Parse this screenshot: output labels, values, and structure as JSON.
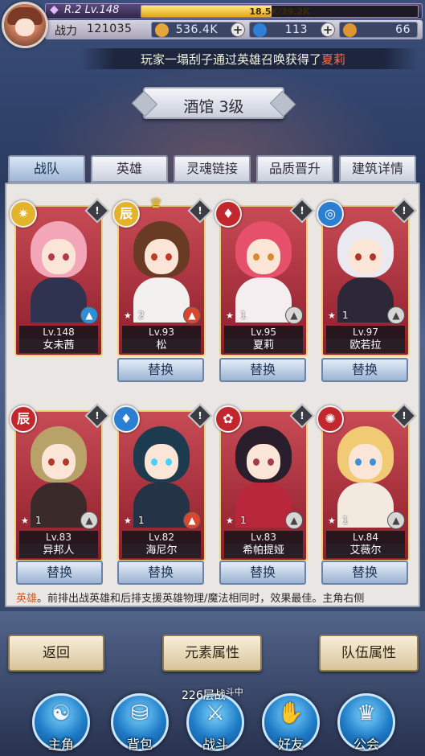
{
  "player": {
    "rank_icon": "rank-gem-icon",
    "rank_text": "R.2 Lv.148",
    "exp_text": "18.5K/39.2K",
    "exp_fraction": 0.47,
    "power_label": "战力",
    "power_value": "121035"
  },
  "resources": [
    {
      "icon": "gold-coin-icon",
      "value": "536.4K",
      "color": "#e5a53a"
    },
    {
      "icon": "blue-gem-icon",
      "value": "113",
      "color": "#2e7fd6"
    },
    {
      "icon": "ticket-icon",
      "value": "66",
      "color": "#e0962f"
    }
  ],
  "announcement": {
    "prefix": "玩家一塌刮子通过英雄召唤获得了",
    "highlight": "夏莉"
  },
  "title": "酒馆 3级",
  "tabs": [
    "战队",
    "英雄",
    "灵魂链接",
    "品质晋升",
    "建筑详情"
  ],
  "heroes": [
    {
      "name": "女未茜",
      "level": "Lv.148",
      "count": "",
      "element_icon": "light-element-icon",
      "elem_color": "#e3b42b",
      "elem_glyph": "✷",
      "role_icon": "water-role-icon",
      "role_class": "water",
      "hair": "#f3a6b8",
      "body": "#2f3350",
      "eye": "#b33a4a"
    },
    {
      "name": "松",
      "level": "Lv.93",
      "count": "2",
      "element_icon": "dark-element-icon",
      "elem_color": "#e3b42b",
      "elem_glyph": "⾠",
      "role_icon": "fire-role-icon",
      "role_class": "fire",
      "hair": "#6a3b24",
      "body": "#f3f0f0",
      "eye": "#c03a2a"
    },
    {
      "name": "夏莉",
      "level": "Lv.95",
      "count": "1",
      "element_icon": "fire-element-icon",
      "elem_color": "#c2272d",
      "elem_glyph": "♦",
      "role_icon": "neutral-role-icon",
      "role_class": "",
      "hair": "#e6506a",
      "body": "#f5eef0",
      "eye": "#d88a2c"
    },
    {
      "name": "欧若拉",
      "level": "Lv.97",
      "count": "1",
      "element_icon": "wind-element-icon",
      "elem_color": "#2a7fd2",
      "elem_glyph": "◎",
      "role_icon": "neutral-role-icon",
      "role_class": "",
      "hair": "#e9e9ef",
      "body": "#2c2838",
      "eye": "#b2342a"
    },
    {
      "name": "异邦人",
      "level": "Lv.83",
      "count": "1",
      "element_icon": "dark-element-icon",
      "elem_color": "#c2272d",
      "elem_glyph": "⾠",
      "role_icon": "neutral-role-icon",
      "role_class": "",
      "hair": "#b9a26a",
      "body": "#3a2a2a",
      "eye": "#b33a2a"
    },
    {
      "name": "海尼尔",
      "level": "Lv.82",
      "count": "1",
      "element_icon": "water-element-icon",
      "elem_color": "#2a7fd2",
      "elem_glyph": "♦",
      "role_icon": "fire-role-icon",
      "role_class": "fire",
      "hair": "#1d3b4f",
      "body": "#243346",
      "eye": "#44d2ff"
    },
    {
      "name": "希帕提娅",
      "level": "Lv.83",
      "count": "1",
      "element_icon": "fire-element-icon",
      "elem_color": "#c2272d",
      "elem_glyph": "✿",
      "role_icon": "neutral-role-icon",
      "role_class": "",
      "hair": "#2a1e2c",
      "body": "#b9273a",
      "eye": "#a63b4e"
    },
    {
      "name": "艾薇尔",
      "level": "Lv.84",
      "count": "1",
      "element_icon": "fire-element-icon",
      "elem_color": "#c2272d",
      "elem_glyph": "✺",
      "role_icon": "neutral-role-icon",
      "role_class": "",
      "hair": "#f0cb74",
      "body": "#f2e9df",
      "eye": "#3f8fd6"
    }
  ],
  "swap_label": "替换",
  "hint": {
    "highlight": "英雄",
    "text": "。前排出战英雄和后排支援英雄物理/魔法相同时，效果最佳。主角右侧"
  },
  "buttons": {
    "back": "返回",
    "element_attr": "元素属性",
    "team_attr": "队伍属性"
  },
  "battle_floor": {
    "text": "226层战",
    "small": "斗中"
  },
  "nav": [
    {
      "label": "主角",
      "icon": "hero-helmet-icon",
      "glyph": "☯"
    },
    {
      "label": "背包",
      "icon": "backpack-icon",
      "glyph": "⛁"
    },
    {
      "label": "战斗",
      "icon": "crossed-swords-icon",
      "glyph": "⚔"
    },
    {
      "label": "好友",
      "icon": "handshake-icon",
      "glyph": "✋"
    },
    {
      "label": "公会",
      "icon": "guild-emblem-icon",
      "glyph": "♛"
    }
  ]
}
